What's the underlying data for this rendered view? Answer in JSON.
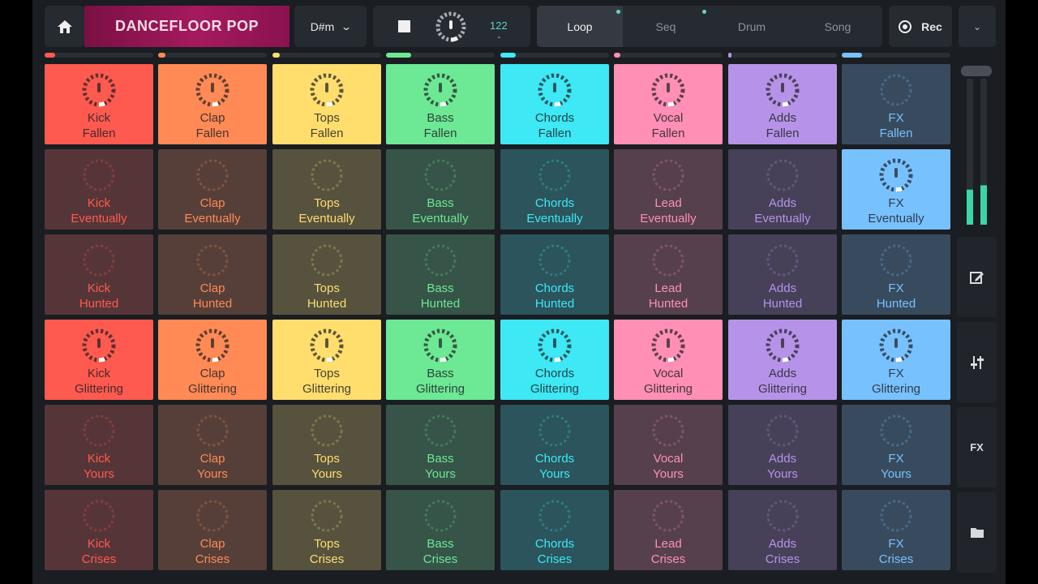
{
  "header": {
    "home_icon": "home-icon",
    "title": "DANCEFLOOR POP",
    "key": "D#m",
    "tempo_bpm": "122",
    "record_label": "Rec",
    "more_icon": "chevron-down-icon"
  },
  "tabs": [
    {
      "label": "Loop",
      "active": true,
      "dot": true
    },
    {
      "label": "Seq",
      "active": false,
      "dot": true
    },
    {
      "label": "Drum",
      "active": false,
      "dot": false
    },
    {
      "label": "Song",
      "active": false,
      "dot": false
    }
  ],
  "colors": {
    "kick": "#ff5a4f",
    "clap": "#ff8a55",
    "tops": "#ffde6e",
    "bass": "#6de895",
    "chords": "#3ee8f5",
    "vocal": "#ff8fb5",
    "adds": "#b693e8",
    "fx": "#78c1ff"
  },
  "columns": [
    {
      "key": "kick",
      "color": "#ff5a4f",
      "progress": 0.1
    },
    {
      "key": "clap",
      "color": "#ff8a55",
      "progress": 0.07
    },
    {
      "key": "tops",
      "color": "#ffde6e",
      "progress": 0.07
    },
    {
      "key": "bass",
      "color": "#6de895",
      "progress": 0.23
    },
    {
      "key": "chords",
      "color": "#3ee8f5",
      "progress": 0.14
    },
    {
      "key": "vocal",
      "color": "#ff8fb5",
      "progress": 0.06
    },
    {
      "key": "adds",
      "color": "#b693e8",
      "progress": 0.02
    },
    {
      "key": "fx",
      "color": "#78c1ff",
      "progress": 0.19
    }
  ],
  "pads": [
    [
      {
        "line1": "Kick",
        "line2": "Fallen",
        "active": true
      },
      {
        "line1": "Clap",
        "line2": "Fallen",
        "active": true
      },
      {
        "line1": "Tops",
        "line2": "Fallen",
        "active": true
      },
      {
        "line1": "Bass",
        "line2": "Fallen",
        "active": true
      },
      {
        "line1": "Chords",
        "line2": "Fallen",
        "active": true
      },
      {
        "line1": "Vocal",
        "line2": "Fallen",
        "active": true
      },
      {
        "line1": "Adds",
        "line2": "Fallen",
        "active": true
      },
      {
        "line1": "FX",
        "line2": "Fallen",
        "active": false
      }
    ],
    [
      {
        "line1": "Kick",
        "line2": "Eventually",
        "active": false
      },
      {
        "line1": "Clap",
        "line2": "Eventually",
        "active": false
      },
      {
        "line1": "Tops",
        "line2": "Eventually",
        "active": false
      },
      {
        "line1": "Bass",
        "line2": "Eventually",
        "active": false
      },
      {
        "line1": "Chords",
        "line2": "Eventually",
        "active": false
      },
      {
        "line1": "Lead",
        "line2": "Eventually",
        "active": false
      },
      {
        "line1": "Adds",
        "line2": "Eventually",
        "active": false
      },
      {
        "line1": "FX",
        "line2": "Eventually",
        "active": true
      }
    ],
    [
      {
        "line1": "Kick",
        "line2": "Hunted",
        "active": false
      },
      {
        "line1": "Clap",
        "line2": "Hunted",
        "active": false
      },
      {
        "line1": "Tops",
        "line2": "Hunted",
        "active": false
      },
      {
        "line1": "Bass",
        "line2": "Hunted",
        "active": false
      },
      {
        "line1": "Chords",
        "line2": "Hunted",
        "active": false
      },
      {
        "line1": "Lead",
        "line2": "Hunted",
        "active": false
      },
      {
        "line1": "Adds",
        "line2": "Hunted",
        "active": false
      },
      {
        "line1": "FX",
        "line2": "Hunted",
        "active": false
      }
    ],
    [
      {
        "line1": "Kick",
        "line2": "Glittering",
        "active": true
      },
      {
        "line1": "Clap",
        "line2": "Glittering",
        "active": true
      },
      {
        "line1": "Tops",
        "line2": "Glittering",
        "active": true
      },
      {
        "line1": "Bass",
        "line2": "Glittering",
        "active": true
      },
      {
        "line1": "Chords",
        "line2": "Glittering",
        "active": true
      },
      {
        "line1": "Vocal",
        "line2": "Glittering",
        "active": true
      },
      {
        "line1": "Adds",
        "line2": "Glittering",
        "active": true
      },
      {
        "line1": "FX",
        "line2": "Glittering",
        "active": true
      }
    ],
    [
      {
        "line1": "Kick",
        "line2": "Yours",
        "active": false
      },
      {
        "line1": "Clap",
        "line2": "Yours",
        "active": false
      },
      {
        "line1": "Tops",
        "line2": "Yours",
        "active": false
      },
      {
        "line1": "Bass",
        "line2": "Yours",
        "active": false
      },
      {
        "line1": "Chords",
        "line2": "Yours",
        "active": false
      },
      {
        "line1": "Vocal",
        "line2": "Yours",
        "active": false
      },
      {
        "line1": "Adds",
        "line2": "Yours",
        "active": false
      },
      {
        "line1": "FX",
        "line2": "Yours",
        "active": false
      }
    ],
    [
      {
        "line1": "Kick",
        "line2": "Crises",
        "active": false
      },
      {
        "line1": "Clap",
        "line2": "Crises",
        "active": false
      },
      {
        "line1": "Tops",
        "line2": "Crises",
        "active": false
      },
      {
        "line1": "Bass",
        "line2": "Crises",
        "active": false
      },
      {
        "line1": "Chords",
        "line2": "Crises",
        "active": false
      },
      {
        "line1": "Lead",
        "line2": "Crises",
        "active": false
      },
      {
        "line1": "Adds",
        "line2": "Crises",
        "active": false
      },
      {
        "line1": "FX",
        "line2": "Crises",
        "active": false
      }
    ]
  ],
  "side_panel": {
    "meter_levels": [
      0.24,
      0.27
    ],
    "edit_icon": "edit-icon",
    "mixer_icon": "mixer-sliders-icon",
    "fx_label": "FX",
    "folder_icon": "folder-icon"
  }
}
